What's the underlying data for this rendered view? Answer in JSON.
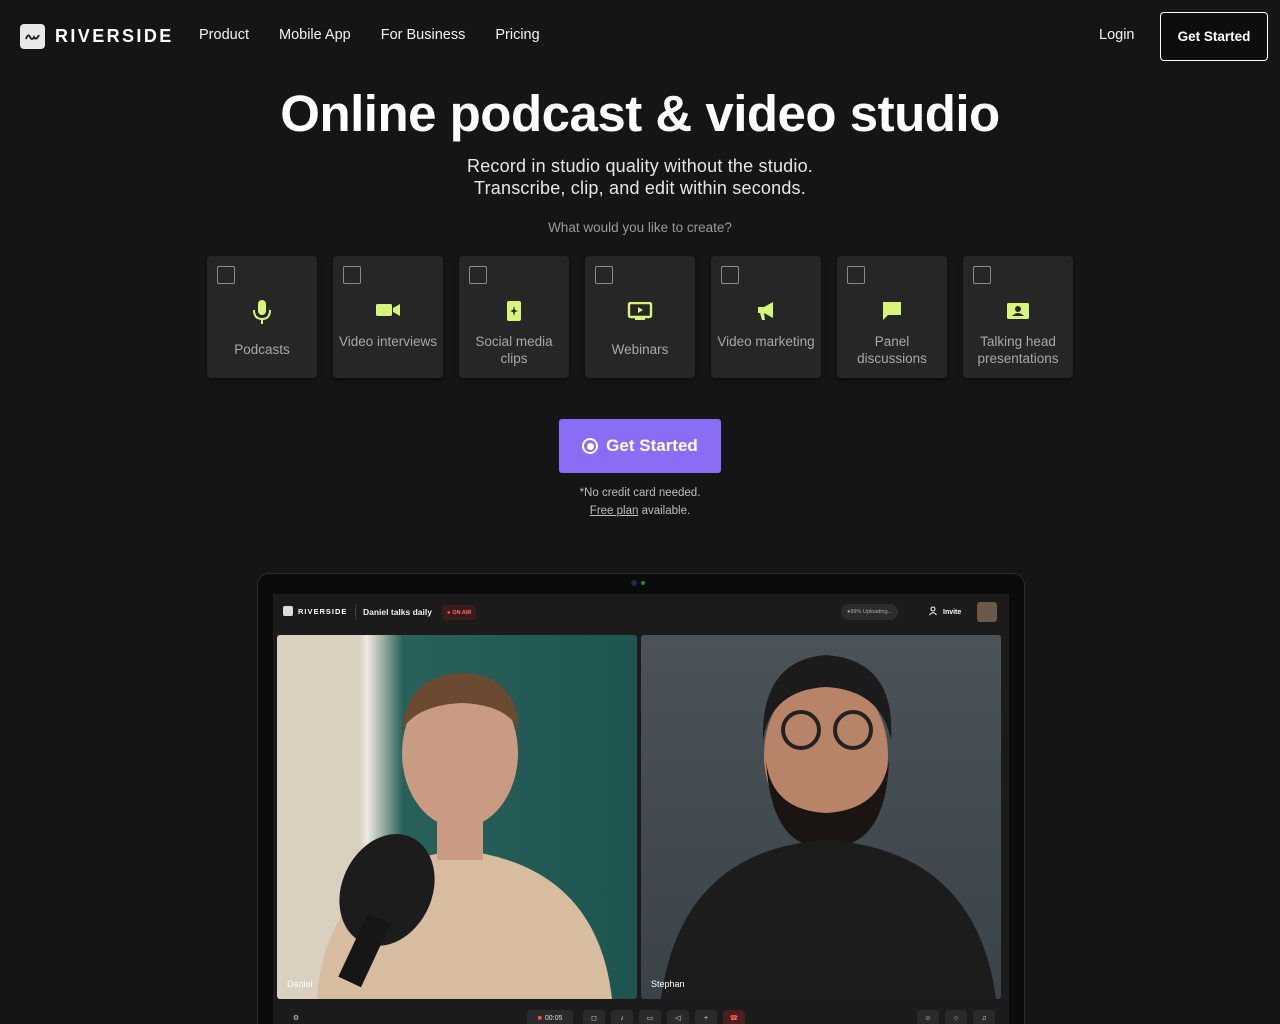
{
  "nav": {
    "brand": "RIVERSIDE",
    "links": [
      "Product",
      "Mobile App",
      "For Business",
      "Pricing"
    ],
    "login": "Login",
    "cta": "Get Started"
  },
  "hero": {
    "title": "Online podcast & video studio",
    "subtitle_line1": "Record in studio quality without the studio.",
    "subtitle_line2": "Transcribe, clip, and edit within seconds.",
    "question": "What would you like to create?"
  },
  "options": [
    {
      "label": "Podcasts",
      "icon": "microphone-icon"
    },
    {
      "label": "Video interviews",
      "icon": "video-camera-icon"
    },
    {
      "label": "Social media clips",
      "icon": "phone-sparkle-icon"
    },
    {
      "label": "Webinars",
      "icon": "screen-play-icon"
    },
    {
      "label": "Video marketing",
      "icon": "megaphone-icon"
    },
    {
      "label": "Panel discussions",
      "icon": "chat-bubble-icon"
    },
    {
      "label": "Talking head presentations",
      "icon": "presenter-icon"
    }
  ],
  "cta": {
    "label": "Get Started",
    "note": "*No credit card needed.",
    "free_plan_link": "Free plan",
    "free_plan_suffix": " available."
  },
  "studio_preview": {
    "brand": "RIVERSIDE",
    "session_name": "Daniel talks daily",
    "status": "ON AIR",
    "upload_status": "99% Uploading...",
    "invite": "Invite",
    "participants": [
      "Daniel",
      "Stephan"
    ],
    "timer": "00:05"
  },
  "colors": {
    "background": "#151515",
    "accent": "#8b6cf5",
    "icon": "#d6f57a"
  }
}
